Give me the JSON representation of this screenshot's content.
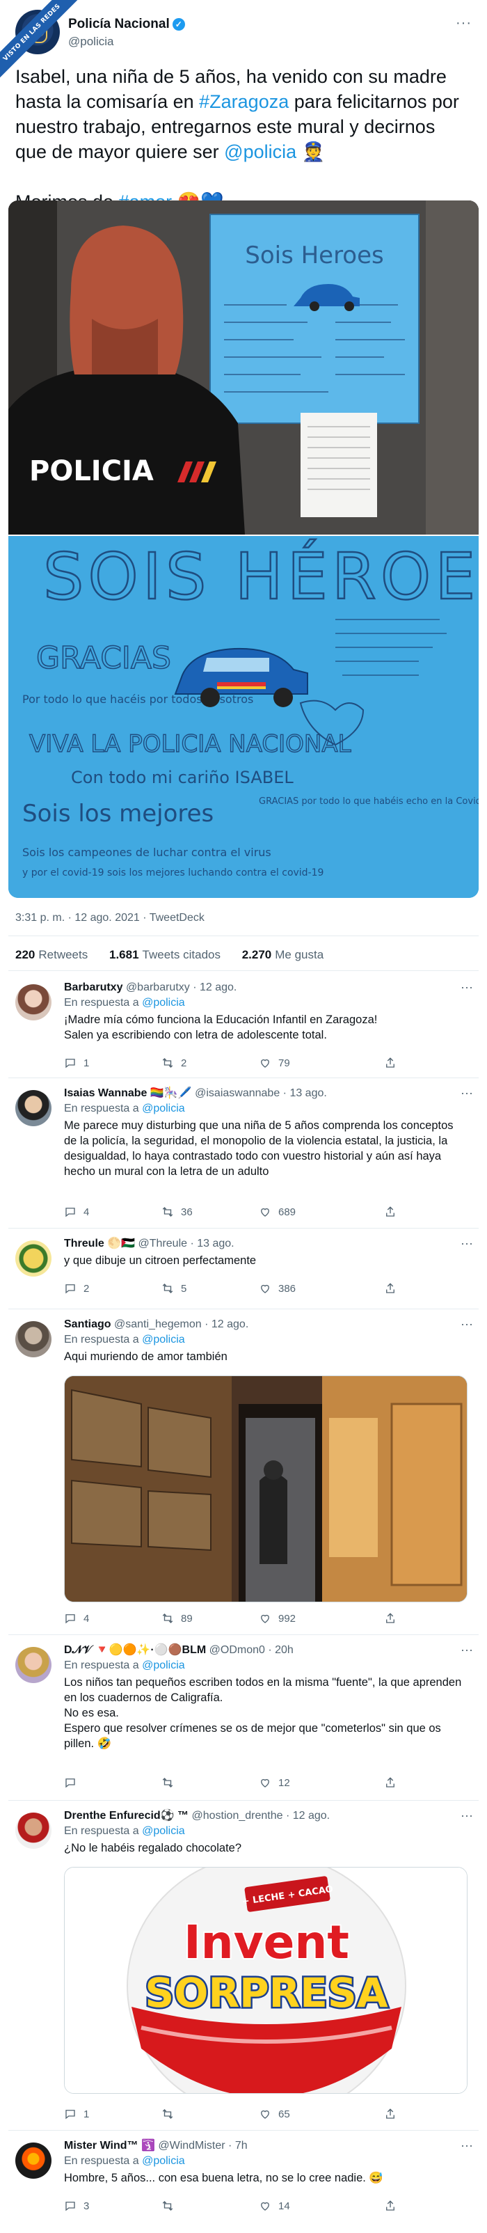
{
  "watermark": "VISTO EN LAS REDES",
  "tweet": {
    "author_name": "Policía Nacional",
    "handle": "@policia",
    "text_1": "Isabel, una niña de 5 años, ha venido con su madre hasta la comisaría en ",
    "tag_zaragoza": "#Zaragoza",
    "text_2": " para felicitarnos por nuestro trabajo, entregarnos este mural y decirnos que de mayor quiere ser ",
    "tag_policia": "@policia",
    "text_3": " 👮",
    "text_4": "Morimos de ",
    "tag_amor": "#amor",
    "text_5": " 😍💙",
    "mural_title": "SOIS HÉROES",
    "mural_lines": [
      "GRACIAS",
      "Por todo lo que hacéis por todos nosotros",
      "VIVA LA POLICIA NACIONAL",
      "Con todo mi cariño ISABEL",
      "Sois los mejores",
      "Sois los campeones de luchar contra el virus",
      "y por el covid-19 sois los mejores luchando contra el covid-19",
      "GRACIAS por todo lo que habéis echo en la Covid y por todo lo que hacéis"
    ],
    "uniform_label": "POLICIA",
    "time": "3:31 p. m. · 12 ago. 2021 · TweetDeck",
    "retweets_count": "220",
    "retweets_label": "Retweets",
    "quotes_count": "1.681",
    "quotes_label": "Tweets citados",
    "likes_count": "2.270",
    "likes_label": "Me gusta"
  },
  "replies": [
    {
      "name": "Barbarutxy",
      "handle": "@barbarutxy · 12 ago.",
      "in_reply_label": "En respuesta a",
      "in_reply_to": "@policia",
      "text": "¡Madre mía cómo funciona la Educación Infantil en Zaragoza!\nSalen ya escribiendo con letra de adolescente total.",
      "replies": "1",
      "retweets": "2",
      "likes": "79"
    },
    {
      "name": "Isaias Wannabe 🏳️‍🌈🎠🖊️",
      "handle": "@isaiaswannabe · 13 ago.",
      "in_reply_label": "En respuesta a",
      "in_reply_to": "@policia",
      "text": "Me parece muy disturbing que una niña de 5 años comprenda los conceptos de la policía, la seguridad, el monopolio de la violencia estatal, la justicia, la desigualdad, lo haya contrastado todo con vuestro historial y aún así haya hecho un mural con la letra de un adulto",
      "replies": "4",
      "retweets": "36",
      "likes": "689"
    },
    {
      "name": "Threule 🌕🇵🇸",
      "handle": "@Threule · 13 ago.",
      "text": "y que dibuje un citroen perfectamente",
      "replies": "2",
      "retweets": "5",
      "likes": "386"
    },
    {
      "name": "Santiago",
      "handle": "@santi_hegemon · 12 ago.",
      "in_reply_label": "En respuesta a",
      "in_reply_to": "@policia",
      "text": "Aqui muriendo de amor también",
      "replies": "4",
      "retweets": "89",
      "likes": "992"
    },
    {
      "name": "D𝒩𝒱 🔻🟡🟠✨·⚪🟤BLM",
      "handle": "@ODmon0 · 20h",
      "in_reply_label": "En respuesta a",
      "in_reply_to": "@policia",
      "text": "Los niños tan pequeños escriben todos en la misma \"fuente\", la que aprenden en los cuadernos de Caligrafía.\nNo es esa.\nEspero que resolver crímenes se os de mejor que \"cometerlos\" sin que os pillen. 🤣",
      "replies": "",
      "retweets": "",
      "likes": "12"
    },
    {
      "name": "Drenthe Enfurecid⚽ ™",
      "handle": "@hostion_drenthe · 12 ago.",
      "in_reply_label": "En respuesta a",
      "in_reply_to": "@policia",
      "text": "¿No le habéis regalado chocolate?",
      "image_brand_top": "Invent",
      "image_brand_bottom": "SORPRESA",
      "image_badge": "+ LECHE + CACAO",
      "replies": "1",
      "retweets": "",
      "likes": "65"
    },
    {
      "name": "Mister Wind™ 🛐",
      "handle": "@WindMister · 7h",
      "in_reply_label": "En respuesta a",
      "in_reply_to": "@policia",
      "text": "Hombre, 5 años... con esa buena letra, no se lo cree nadie. 😅",
      "replies": "3",
      "retweets": "",
      "likes": "14"
    }
  ],
  "more_label": "···",
  "colors": {
    "link": "#1b95e0",
    "muted": "#536471",
    "verified": "#1d9bf0"
  }
}
